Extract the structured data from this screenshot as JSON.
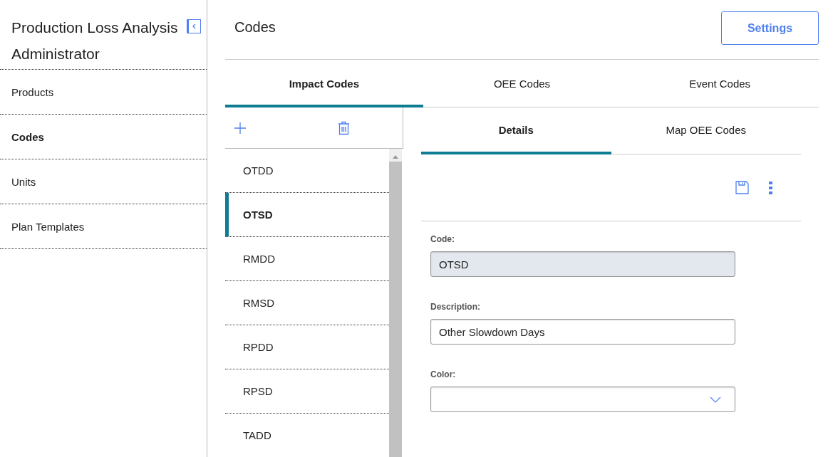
{
  "sidebar": {
    "title": "Production Loss Analysis Administrator",
    "items": [
      {
        "label": "Products",
        "selected": false
      },
      {
        "label": "Codes",
        "selected": true
      },
      {
        "label": "Units",
        "selected": false
      },
      {
        "label": "Plan Templates",
        "selected": false
      }
    ]
  },
  "page": {
    "title": "Codes",
    "settings_button": "Settings"
  },
  "tabs": [
    {
      "label": "Impact Codes",
      "selected": true
    },
    {
      "label": "OEE Codes",
      "selected": false
    },
    {
      "label": "Event Codes",
      "selected": false
    }
  ],
  "code_list": [
    {
      "label": "OTDD",
      "selected": false
    },
    {
      "label": "OTSD",
      "selected": true
    },
    {
      "label": "RMDD",
      "selected": false
    },
    {
      "label": "RMSD",
      "selected": false
    },
    {
      "label": "RPDD",
      "selected": false
    },
    {
      "label": "RPSD",
      "selected": false
    },
    {
      "label": "TADD",
      "selected": false
    }
  ],
  "detail_tabs": [
    {
      "label": "Details",
      "selected": true
    },
    {
      "label": "Map OEE Codes",
      "selected": false
    }
  ],
  "fields": [
    {
      "label": "Code:",
      "kind": "readonly",
      "value": "OTSD"
    },
    {
      "label": "Description:",
      "kind": "text",
      "value": "Other Slowdown Days"
    },
    {
      "label": "Color:",
      "kind": "dropdown"
    }
  ]
}
